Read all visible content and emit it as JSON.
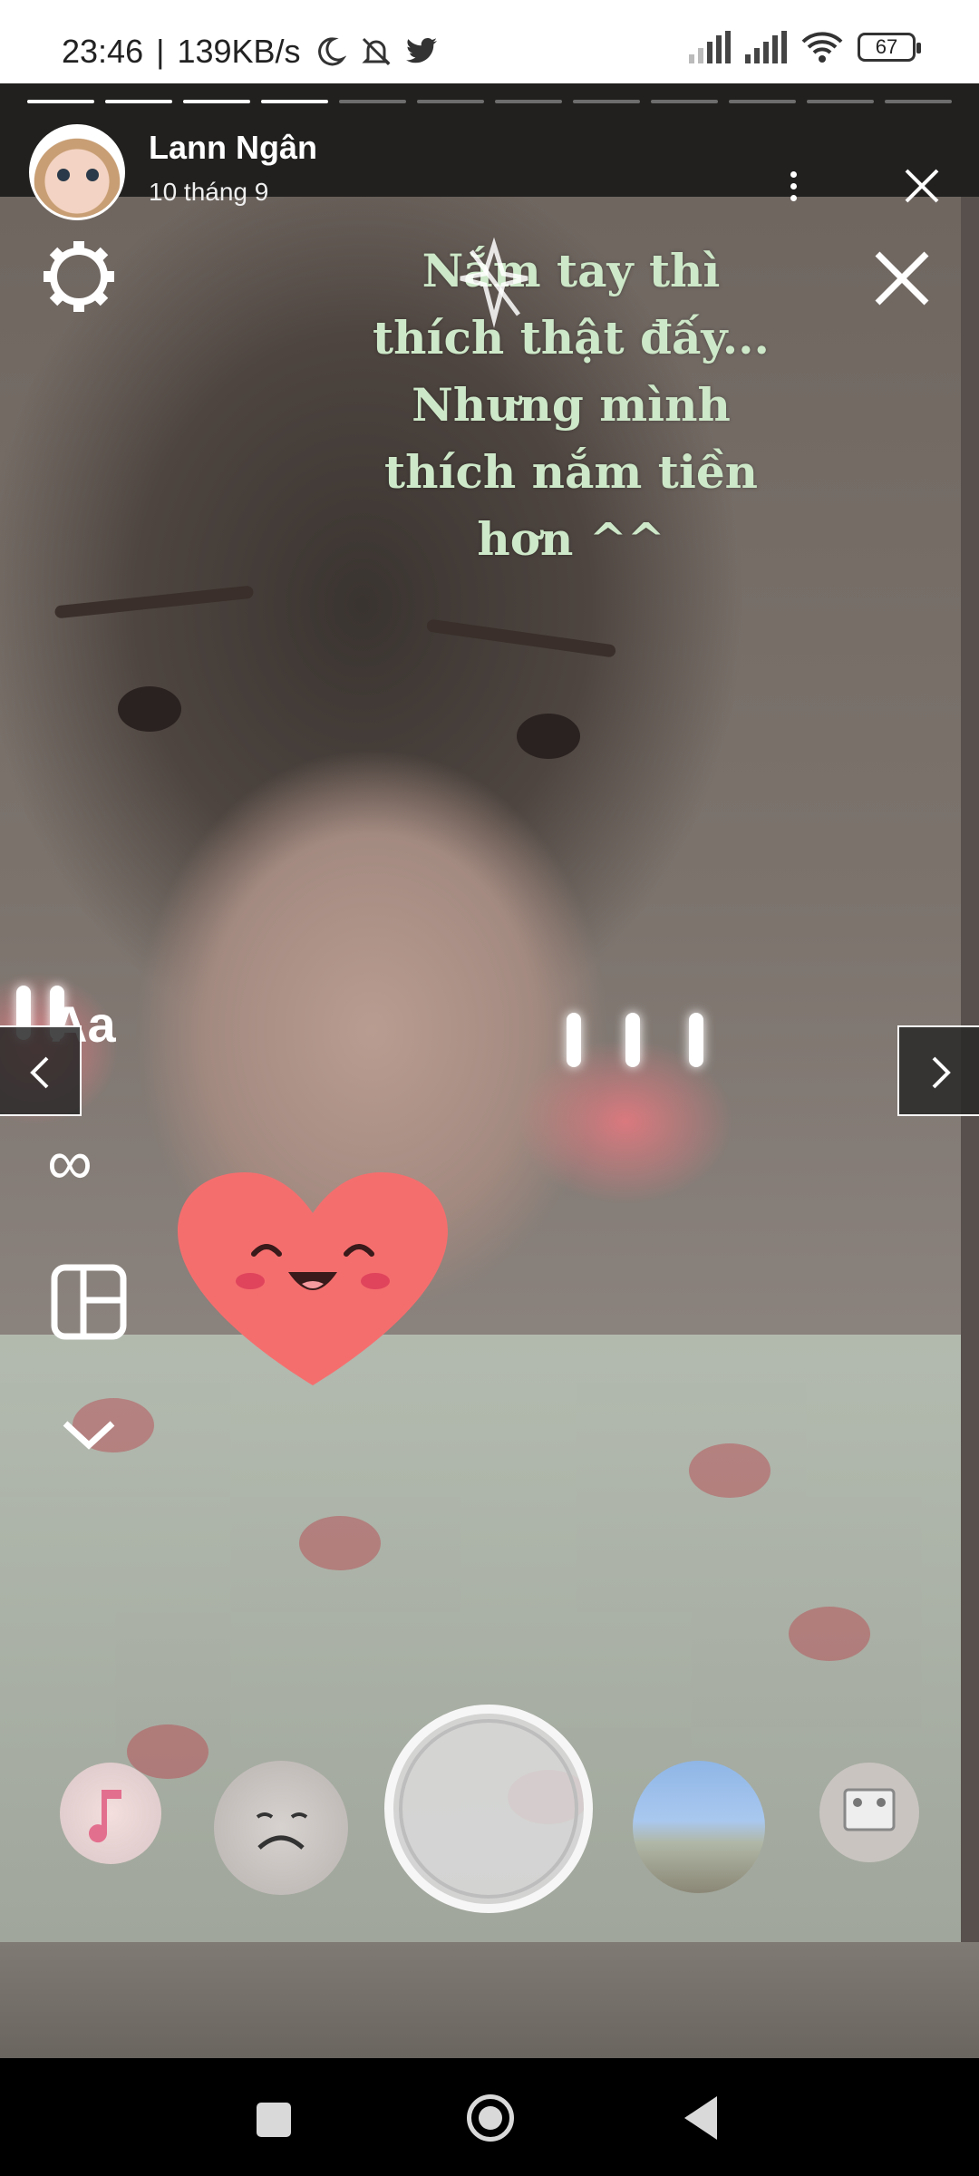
{
  "status_bar": {
    "time": "23:46",
    "separator": "|",
    "net_speed": "139KB/s",
    "battery_level": "67",
    "icons": [
      "moon-icon",
      "bell-off-icon",
      "twitter-icon",
      "cell-signal-icon",
      "cell-signal-icon",
      "wifi-icon",
      "battery-icon"
    ]
  },
  "story": {
    "user_name": "Lann Ngân",
    "date": "10 tháng 9",
    "progress_total": 12,
    "progress_done": 4,
    "caption": "Nắm tay thì thích thật đấy... Nhưng mình thích nắm tiền hơn ^^",
    "side_tools": {
      "text_label": "Aa",
      "boomerang_label": "∞"
    },
    "colors": {
      "caption": "#cde8c8",
      "heart": "#f56e6e"
    }
  }
}
